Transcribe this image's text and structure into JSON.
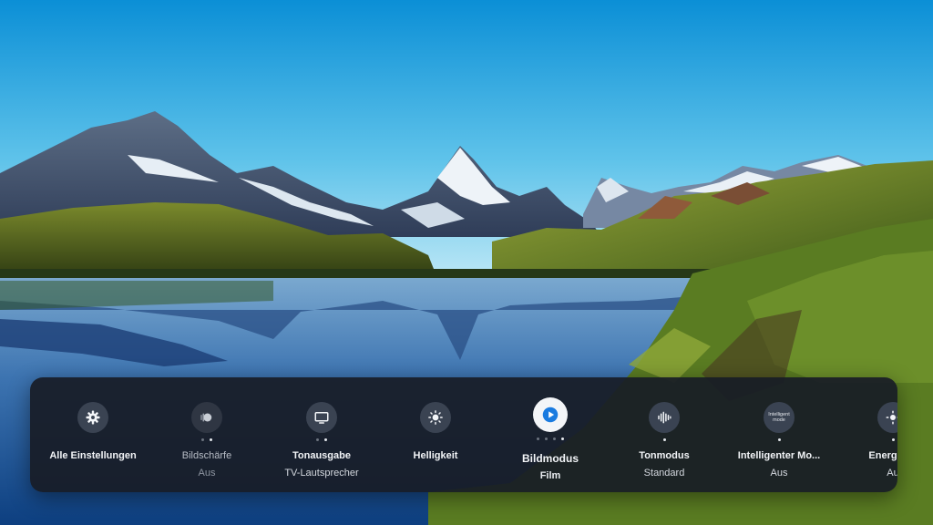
{
  "quick_settings": {
    "items": [
      {
        "label": "Alle Einstellungen",
        "value": "",
        "icon": "gear-icon"
      },
      {
        "label": "Bildschärfe",
        "value": "Aus",
        "icon": "sharpness-icon"
      },
      {
        "label": "Tonausgabe",
        "value": "TV-Lautsprecher",
        "icon": "tv-icon"
      },
      {
        "label": "Helligkeit",
        "value": "",
        "icon": "sun-icon"
      },
      {
        "label": "Bildmodus",
        "value": "Film",
        "icon": "play-icon"
      },
      {
        "label": "Tonmodus",
        "value": "Standard",
        "icon": "sound-wave-icon"
      },
      {
        "label": "Intelligenter Mo...",
        "value": "Aus",
        "icon": "intelligent-mode-icon",
        "icon_text": "Intelligent mode"
      },
      {
        "label": "Energiesp",
        "value": "Au",
        "icon": "energy-icon"
      }
    ],
    "focused_index": 4
  },
  "colors": {
    "sky_top": "#0b8fd6",
    "sky_horizon": "#bfe7f6",
    "bar_background": "#181c26",
    "focused_icon": "#1a7be0"
  }
}
